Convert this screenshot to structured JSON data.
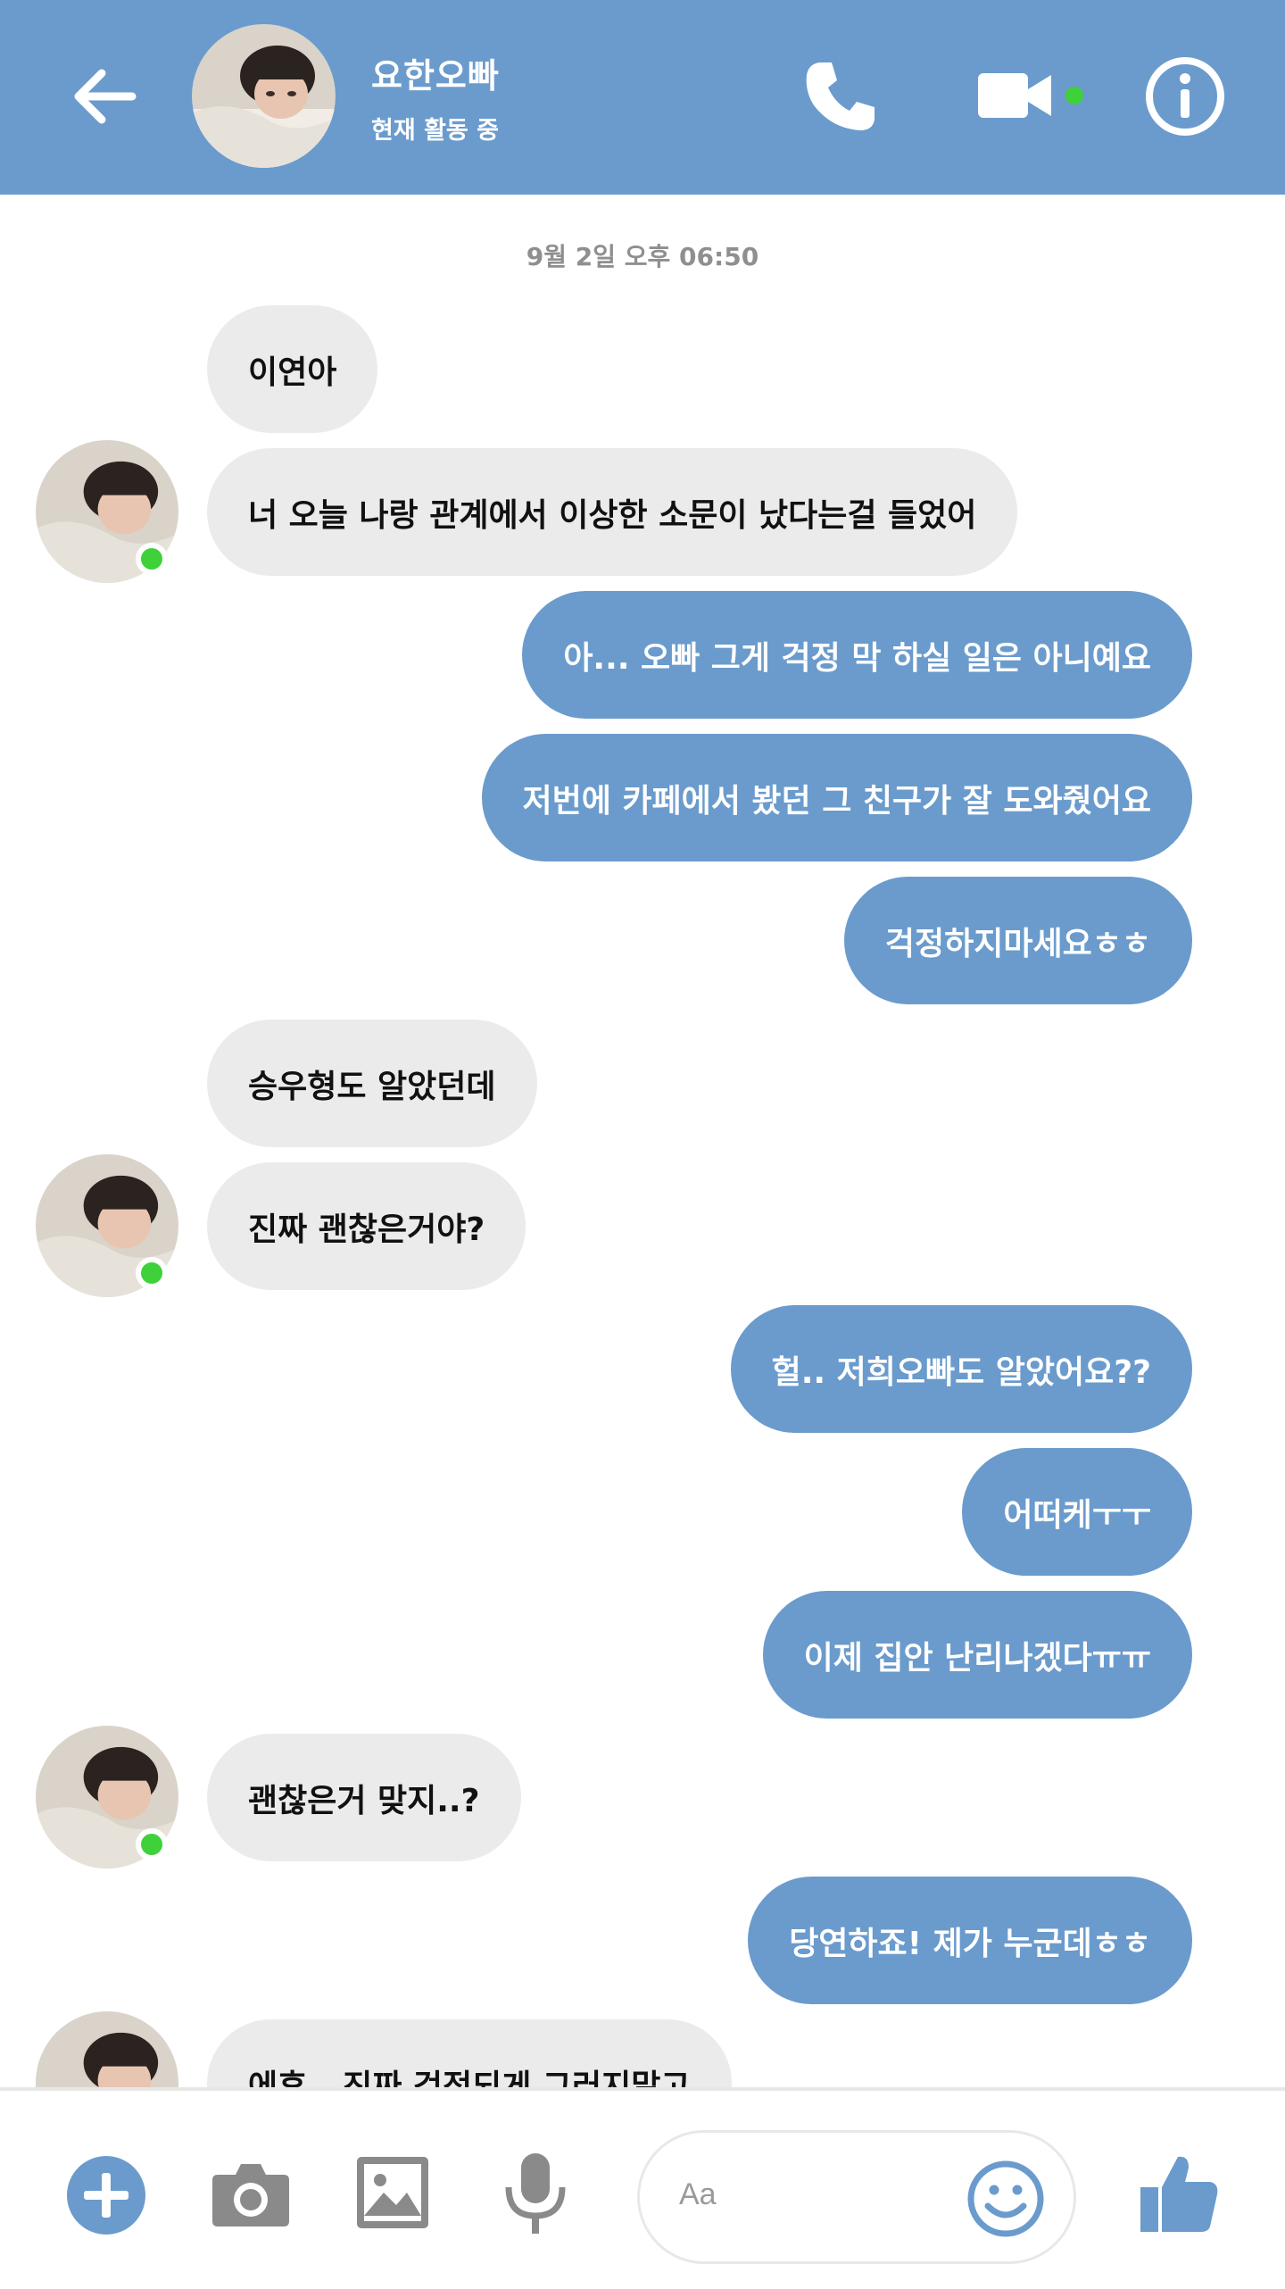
{
  "header": {
    "name": "요한오빠",
    "status": "현재 활동 중"
  },
  "timestamp": "9월 2일 오후 06:50",
  "messages": [
    {
      "side": "in",
      "text": "이연아"
    },
    {
      "side": "in",
      "text": "너 오늘 나랑 관계에서 이상한 소문이 났다는걸 들었어"
    },
    {
      "side": "out",
      "text": "아... 오빠 그게 걱정 막 하실 일은 아니예요"
    },
    {
      "side": "out",
      "text": "저번에 카페에서 봤던 그 친구가 잘 도와줬어요"
    },
    {
      "side": "out",
      "text": "걱정하지마세요ㅎㅎ"
    },
    {
      "side": "in",
      "text": "승우형도 알았던데"
    },
    {
      "side": "in",
      "text": "진짜 괜찮은거야?"
    },
    {
      "side": "out",
      "text": "헐.. 저희오빠도 알았어요??"
    },
    {
      "side": "out",
      "text": "어떠케ㅜㅜ"
    },
    {
      "side": "out",
      "text": "이제 집안 난리나겠다ㅠㅠ"
    },
    {
      "side": "in",
      "text": "괜찮은거 맞지..?"
    },
    {
      "side": "out",
      "text": "당연하죠! 제가 누군데ㅎㅎ"
    },
    {
      "side": "in",
      "text": "에휴.. 진짜 걱정되게 그러지말고"
    }
  ],
  "composer": {
    "placeholder": "Aa"
  },
  "colors": {
    "accent": "#6a9bcc",
    "incoming_bubble": "#ebebeb",
    "online": "#3fd13a"
  },
  "icons": {
    "back": "arrow-left-icon",
    "call": "phone-icon",
    "video": "video-camera-icon",
    "info": "info-icon",
    "add": "plus-circle-icon",
    "camera": "camera-icon",
    "gallery": "image-icon",
    "voice": "microphone-icon",
    "emoji": "smiley-icon",
    "like": "thumbs-up-icon"
  }
}
